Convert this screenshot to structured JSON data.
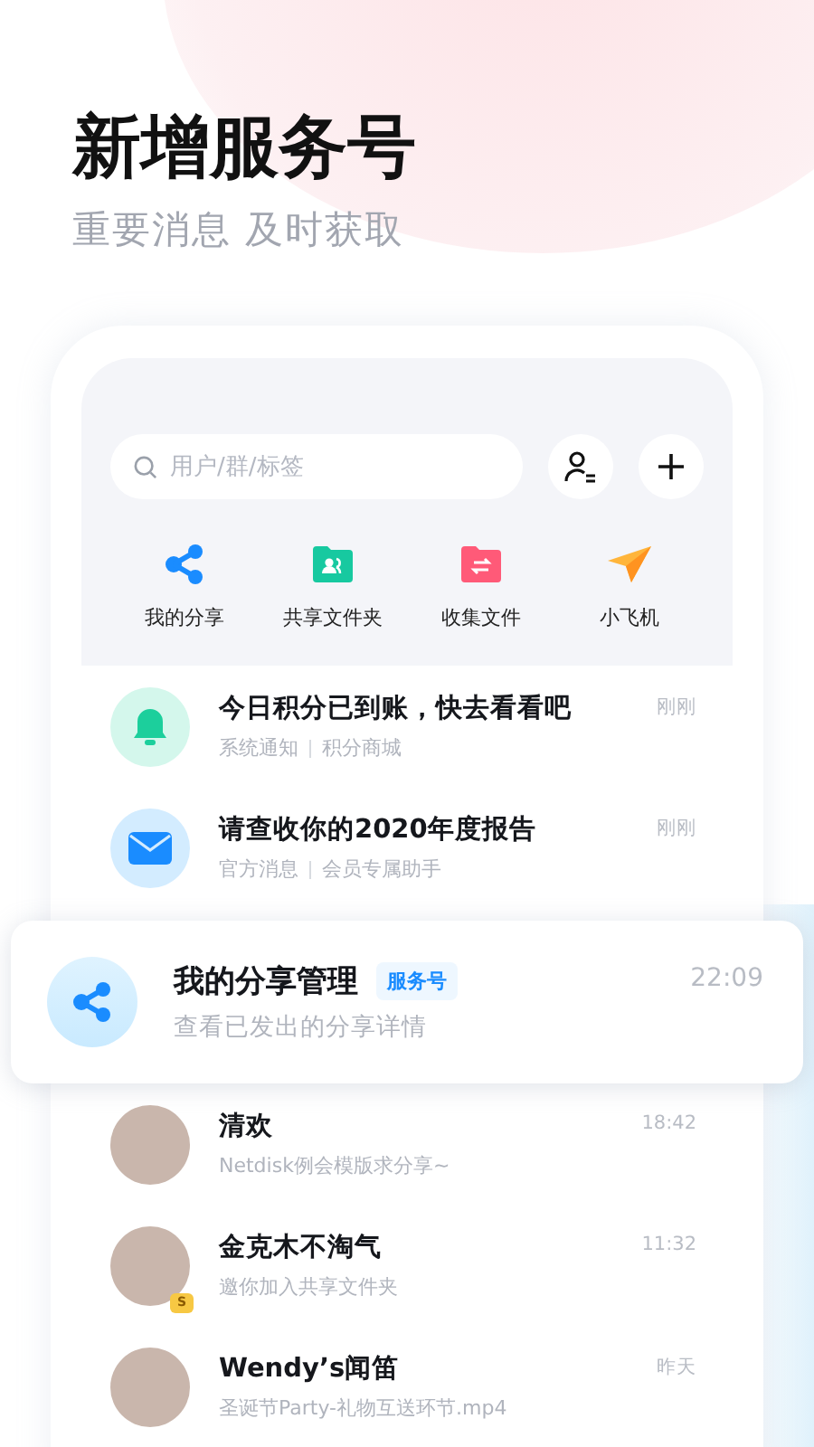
{
  "headline": "新增服务号",
  "subtitle": "重要消息 及时获取",
  "search": {
    "placeholder": "用户/群/标签"
  },
  "shortcuts": [
    {
      "label": "我的分享",
      "kind": "share"
    },
    {
      "label": "共享文件夹",
      "kind": "folder-people"
    },
    {
      "label": "收集文件",
      "kind": "folder-collect"
    },
    {
      "label": "小飞机",
      "kind": "plane"
    }
  ],
  "messages": [
    {
      "kind": "bell",
      "title": "今日积分已到账，快去看看吧",
      "sources": [
        "系统通知",
        "积分商城"
      ],
      "time": "刚刚"
    },
    {
      "kind": "mail",
      "title": "请查收你的2020年度报告",
      "sources": [
        "官方消息",
        "会员专属助手"
      ],
      "time": "刚刚"
    }
  ],
  "featured": {
    "title": "我的分享管理",
    "tag": "服务号",
    "subtitle": "查看已发出的分享详情",
    "time": "22:09"
  },
  "chats": [
    {
      "name": "清欢",
      "preview": "Netdisk例会模版求分享~",
      "time": "18:42"
    },
    {
      "name": "金克木不淘气",
      "preview": "邀你加入共享文件夹",
      "time": "11:32",
      "badge": "S"
    },
    {
      "name": "Wendy’s闻笛",
      "preview": "圣诞节Party-礼物互送环节.mp4",
      "time": "昨天"
    }
  ]
}
